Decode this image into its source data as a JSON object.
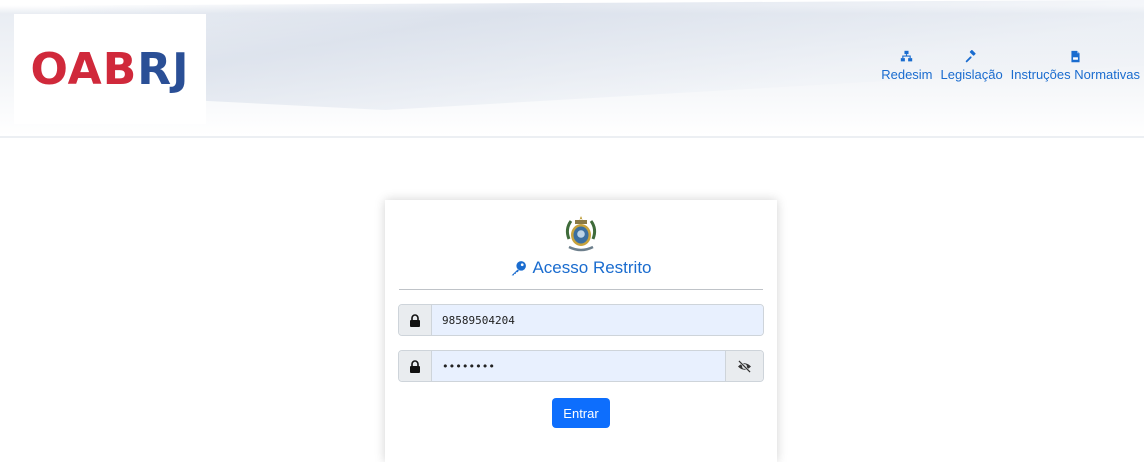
{
  "header": {
    "logo": {
      "part1": "OAB",
      "part2": "RJ"
    },
    "nav": [
      {
        "label": "Redesim",
        "icon": "sitemap-icon"
      },
      {
        "label": "Legislação",
        "icon": "gavel-icon"
      },
      {
        "label": "Instruções Normativas",
        "icon": "file-pdf-icon"
      }
    ]
  },
  "login": {
    "title": "Acesso Restrito",
    "title_icon": "key-icon",
    "crest_icon": "coat-of-arms-icon",
    "username": {
      "value": "98589504204",
      "icon": "lock-icon"
    },
    "password": {
      "value": "••••••••",
      "icon": "lock-icon",
      "toggle_icon": "eye-slash-icon"
    },
    "submit_label": "Entrar"
  },
  "colors": {
    "accent": "#1a6ccf",
    "button": "#0d6efd",
    "logo_red": "#d0293b",
    "logo_blue": "#2a4f96",
    "input_bg": "#e8f0fe"
  }
}
